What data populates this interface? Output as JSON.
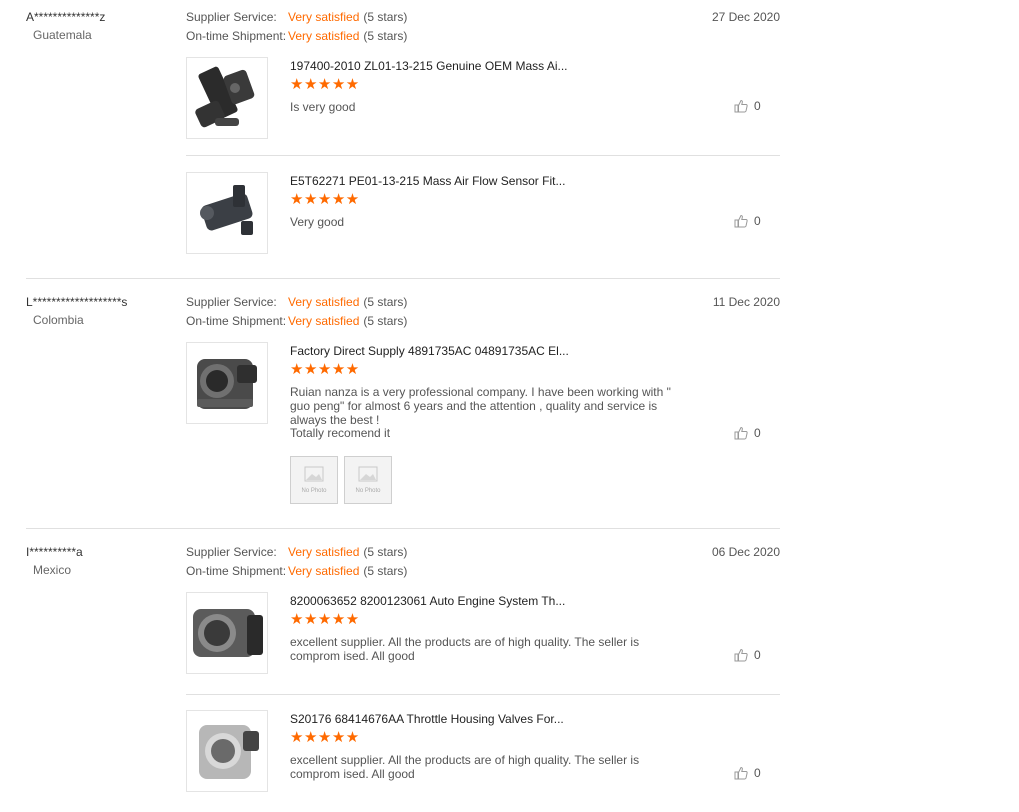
{
  "like_icon": "thumbs-up-icon",
  "star_icon": "star-icon",
  "star_color": "#ff6a00",
  "reviews": [
    {
      "buyer": "A**************z",
      "country": "Guatemala",
      "supplier_service_label": "Supplier Service:",
      "supplier_service_value": "Very satisfied",
      "supplier_service_stars": "(5 stars)",
      "shipment_label": "On-time Shipment:",
      "shipment_value": "Very satisfied",
      "shipment_stars": "(5 stars)",
      "date": "27 Dec 2020",
      "products": [
        {
          "name": "197400-2010 ZL01-13-215 Genuine OEM Mass Ai...",
          "rating": 5,
          "stars": "★★★★★",
          "comment": "Is very good",
          "likes": "0"
        },
        {
          "name": "E5T62271 PE01-13-215 Mass Air Flow Sensor Fit...",
          "rating": 5,
          "stars": "★★★★★",
          "comment": "Very good",
          "likes": "0"
        }
      ]
    },
    {
      "buyer": "L*******************s",
      "country": "Colombia",
      "supplier_service_label": "Supplier Service:",
      "supplier_service_value": "Very satisfied",
      "supplier_service_stars": "(5 stars)",
      "shipment_label": "On-time Shipment:",
      "shipment_value": "Very satisfied",
      "shipment_stars": "(5 stars)",
      "date": "11 Dec 2020",
      "products": [
        {
          "name": "Factory Direct Supply 4891735AC 04891735AC El...",
          "rating": 5,
          "stars": "★★★★★",
          "comment": "Ruian nanza  is a very professional company. I have been working with \" guo peng\" for almost 6 years and the attention , quality and service is always the best !",
          "comment2": "Totally recomend it",
          "likes": "0",
          "photo_placeholder": "No Photo"
        }
      ]
    },
    {
      "buyer": "I**********a",
      "country": "Mexico",
      "supplier_service_label": "Supplier Service:",
      "supplier_service_value": "Very satisfied",
      "supplier_service_stars": "(5 stars)",
      "shipment_label": "On-time Shipment:",
      "shipment_value": "Very satisfied",
      "shipment_stars": "(5 stars)",
      "date": "06 Dec 2020",
      "products": [
        {
          "name": "8200063652 8200123061 Auto Engine System Th...",
          "rating": 5,
          "stars": "★★★★★",
          "comment": "excellent supplier. All the products are of high quality. The seller is comprom ised. All good",
          "likes": "0"
        },
        {
          "name": "S20176 68414676AA Throttle Housing Valves For...",
          "rating": 5,
          "stars": "★★★★★",
          "comment": "excellent supplier. All the products are of high quality. The seller is comprom ised. All good",
          "likes": "0"
        }
      ]
    }
  ]
}
